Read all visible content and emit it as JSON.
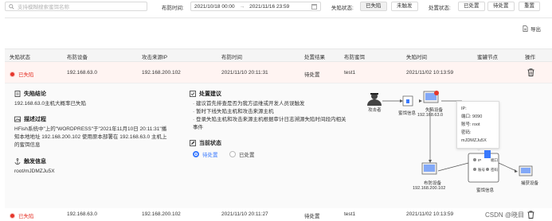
{
  "filter": {
    "search_placeholder": "支持模糊搜索蜜饵名称",
    "deploy_time_label": "布防时间:",
    "date_start": "2021/10/18 00:00",
    "date_arrow": "→",
    "date_end": "2021/11/16 23:59",
    "lost_status_label": "失陷状态:",
    "lost_options": [
      "已失陷",
      "未触发"
    ],
    "handle_status_label": "处置状态:",
    "handle_options": [
      "已处置",
      "待处置"
    ],
    "reset_label": "重置"
  },
  "toolbar": {
    "export_label": "导出"
  },
  "table": {
    "columns": [
      "失陷状态",
      "布防设备",
      "攻击来源IP",
      "布防时间",
      "处置结果",
      "布防蜜饵",
      "失陷时间",
      "蜜罐节点",
      "操作"
    ],
    "rows": [
      {
        "status": "已失陷",
        "device": "192.168.63.0",
        "source_ip": "192.168.200.102",
        "deploy_time": "2021/11/10 20:11:31",
        "result": "待处置",
        "bait": "test1",
        "lost_time": "2021/11/02 10:13:59",
        "node": ""
      },
      {
        "status": "已失陷",
        "device": "192.168.63.0",
        "source_ip": "192.168.200.102",
        "deploy_time": "2021/11/10 20:11:27",
        "result": "待处置",
        "bait": "test1",
        "lost_time": "2021/11/02 10:13:59",
        "node": ""
      }
    ]
  },
  "detail": {
    "conclusion_title": "失陷结论",
    "conclusion_text": "192.168.63.0主机大概率已失陷",
    "process_title": "描述过程",
    "process_text_1": "HFish系统中\"上的\"WORDPRESS\"于\"2021年11月10日 20:11:31\"播",
    "process_text_2": "知本地地址 192.168.200.102 使用原本部署在 192.168.63.0 主机上",
    "process_text_3": "的蜜饵信息",
    "trigger_title": "触发信息",
    "trigger_text": "root/mJDMZJu5X",
    "suggest_title": "处置建议",
    "suggest_1": "· 建议首先排查是否为我方运维或开发人员误触发",
    "suggest_2": "· 暂时下线失陷主机和攻击来源主机",
    "suggest_3": "· 登录失陷主机和攻击来源主机根据审计日志溯源失陷时间段内相关",
    "suggest_4": "事件",
    "state_title": "当前状态",
    "state_options": [
      "待处置",
      "已处置"
    ]
  },
  "diagram": {
    "attacker_label": "攻击者",
    "bait_info_label": "蜜饵信息",
    "lost_device_label": "失陷设备",
    "lost_device_ip": "192.168.63.0",
    "deploy_device_label": "布防设备",
    "deploy_device_ip": "192.168.200.102",
    "honeypot_label": "蜜饵信息",
    "capture_label": "捕获设备",
    "node_ip_label": "IP",
    "node_port_label": "端口",
    "node_account_label": "账号",
    "node_password_label": "密码",
    "popup_ip": "IP:",
    "popup_port": "端口: 9090",
    "popup_account": "账号: root",
    "popup_password_label": "密码:",
    "popup_password": "mJDMZJu5X"
  },
  "watermark": "CSDN @晓目",
  "colors": {
    "accent": "#3a7afe",
    "danger": "#e5362b"
  }
}
